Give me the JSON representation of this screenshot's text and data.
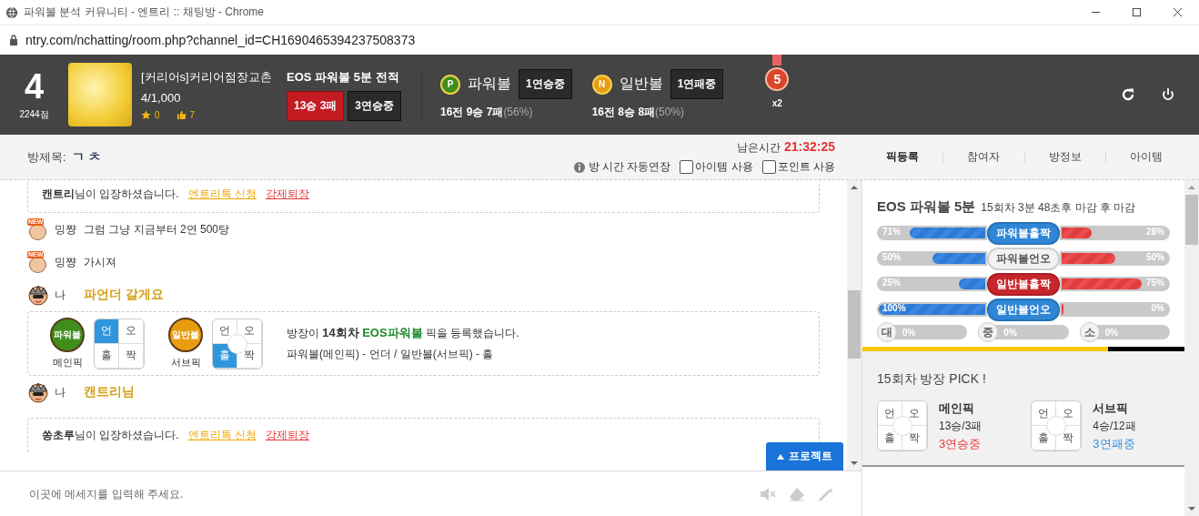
{
  "window": {
    "title": "파워볼 분석 커뮤니티 - 엔트리 :: 채팅방 - Chrome",
    "url": "ntry.com/nchatting/room.php?channel_id=CH1690465394237508373"
  },
  "header": {
    "rank": "4",
    "points": "2244점",
    "room_name": "[커리어s]커리어점장교촌",
    "members": "4/1,000",
    "stars": "0",
    "likes": "7",
    "record": {
      "title": "EOS 파워볼 5분 전적",
      "result": "13승 3패",
      "streak": "3연승중"
    },
    "balls": [
      {
        "badge": "P",
        "color": "#3f8e1c",
        "name": "파워볼",
        "streak": "1연승중",
        "record": "16전 9승 7패",
        "rate": "(56%)"
      },
      {
        "badge": "N",
        "color": "#e89c10",
        "name": "일반볼",
        "streak": "1연패중",
        "record": "16전 8승 8패",
        "rate": "(50%)"
      }
    ],
    "medal": {
      "number": "5",
      "multiplier": "x2"
    }
  },
  "room_bar": {
    "title_label": "방제목:",
    "title": "ㄱ ㅊ",
    "time_label": "남은시간",
    "time": "21:32:25",
    "auto_extend": "방 시간 자동연장",
    "options": [
      {
        "label": "아이템 사용",
        "checked": false
      },
      {
        "label": "포인트 사용",
        "checked": false
      }
    ],
    "tabs": [
      {
        "label": "픽등록",
        "selected": true
      },
      {
        "label": "참여자",
        "selected": false
      },
      {
        "label": "방정보",
        "selected": false
      },
      {
        "label": "아이템",
        "selected": false
      }
    ]
  },
  "chat": {
    "messages": [
      {
        "kind": "system",
        "text": "**캔트리**님이 입장하셨습니다.",
        "links": [
          {
            "label": "엔트리톡 신청",
            "color": "#f0a800"
          },
          {
            "label": "강제퇴장",
            "color": "#e83a3a"
          }
        ]
      },
      {
        "kind": "user",
        "badge": "NEW",
        "name": "밍쨩",
        "text": "그럼 그냥 지금부터 2연 500탕"
      },
      {
        "kind": "user",
        "badge": "NEW",
        "name": "밍쨩",
        "text": "가시져"
      },
      {
        "kind": "me",
        "name": "나",
        "text": "파언더 갈게요"
      },
      {
        "kind": "pick",
        "picks": [
          {
            "ball": "파워볼",
            "color": "#3f8e1c",
            "label": "메인픽",
            "cells": [
              {
                "label": "언",
                "selected": true
              },
              {
                "label": "오",
                "selected": false
              },
              {
                "label": "홀",
                "selected": false
              },
              {
                "label": "짝",
                "selected": false
              }
            ]
          },
          {
            "ball": "일반볼",
            "color": "#e89c10",
            "label": "서브픽",
            "cells": [
              {
                "label": "언",
                "selected": false
              },
              {
                "label": "오",
                "selected": false
              },
              {
                "label": "홀",
                "selected": true
              },
              {
                "label": "짝",
                "selected": false
              }
            ]
          }
        ],
        "announcement": {
          "prefix": "방장이",
          "round": "14회차",
          "game": "EOS파워볼",
          "suffix": "픽을 등록했습니다."
        },
        "detail": "파워볼(메인픽) - 언더 / 일반볼(서브픽) - 홀"
      },
      {
        "kind": "me",
        "name": "나",
        "text": "캔트리님"
      },
      {
        "kind": "system",
        "text": "**쏭초루**님이 입장하셨습니다.",
        "links": [
          {
            "label": "엔트리톡 신청",
            "color": "#f0a800"
          },
          {
            "label": "강제퇴장",
            "color": "#e83a3a"
          }
        ]
      }
    ],
    "project_button": "프로젝트",
    "input": {
      "placeholder": "이곳에 메세지를 입력해 주세요."
    }
  },
  "panel": {
    "title": "EOS 파워볼 5분",
    "subtitle": "15회차 3분 48초후 마감 후 마감",
    "bars": [
      {
        "label": "파워볼홀짝",
        "color": "#2f86d6",
        "left": {
          "reading": "71%",
          "level": 0.71
        },
        "right": {
          "reading": "28%",
          "level": 0.28
        }
      },
      {
        "label": "파워볼언오",
        "color": "#f2f2f2",
        "left": {
          "reading": "50%",
          "level": 0.5
        },
        "right": {
          "reading": "50%",
          "level": 0.5
        }
      },
      {
        "label": "일반볼홀짝",
        "color": "#c8262b",
        "left": {
          "reading": "25%",
          "level": 0.25
        },
        "right": {
          "reading": "75%",
          "level": 0.75
        }
      },
      {
        "label": "일반볼언오",
        "color": "#2f86d6",
        "left": {
          "reading": "100%",
          "level": 1
        },
        "right": {
          "reading": "0%",
          "level": 0
        }
      }
    ],
    "sizes": [
      {
        "label": "대",
        "reading": "0%",
        "level": 0
      },
      {
        "label": "중",
        "reading": "0%",
        "level": 0
      },
      {
        "label": "소",
        "reading": "0%",
        "level": 0
      }
    ],
    "pick_title": "15회차 방장 PICK !",
    "picks": [
      {
        "label": "메인픽",
        "record": "13승/3패",
        "streak": "3연승중",
        "color": "#e53935",
        "cells": [
          {
            "label": "언",
            "selected": false
          },
          {
            "label": "오",
            "selected": false
          },
          {
            "label": "홀",
            "selected": false
          },
          {
            "label": "짝",
            "selected": false
          }
        ]
      },
      {
        "label": "서브픽",
        "record": "4승/12패",
        "streak": "3연패중",
        "color": "#2f8ee0",
        "cells": [
          {
            "label": "언",
            "selected": false
          },
          {
            "label": "오",
            "selected": false
          },
          {
            "label": "홀",
            "selected": false
          },
          {
            "label": "짝",
            "selected": false
          }
        ]
      }
    ]
  }
}
